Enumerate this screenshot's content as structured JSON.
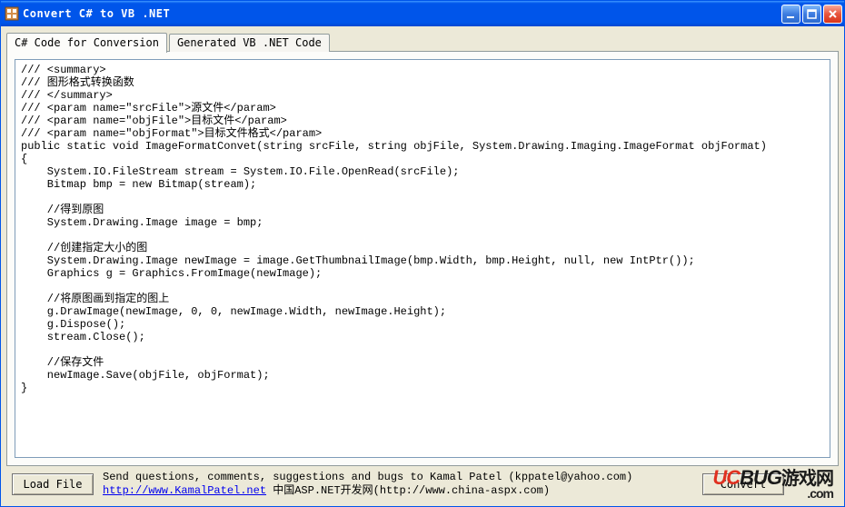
{
  "window": {
    "title": "Convert C# to VB .NET"
  },
  "tabs": {
    "csharp": "C# Code for Conversion",
    "vb": "Generated VB .NET Code"
  },
  "code": "/// <summary>\n/// 图形格式转换函数\n/// </summary>\n/// <param name=\"srcFile\">源文件</param>\n/// <param name=\"objFile\">目标文件</param>\n/// <param name=\"objFormat\">目标文件格式</param>\npublic static void ImageFormatConvet(string srcFile, string objFile, System.Drawing.Imaging.ImageFormat objFormat)\n{\n    System.IO.FileStream stream = System.IO.File.OpenRead(srcFile);\n    Bitmap bmp = new Bitmap(stream);\n\n    //得到原图\n    System.Drawing.Image image = bmp;\n\n    //创建指定大小的图\n    System.Drawing.Image newImage = image.GetThumbnailImage(bmp.Width, bmp.Height, null, new IntPtr());\n    Graphics g = Graphics.FromImage(newImage);\n\n    //将原图画到指定的图上\n    g.DrawImage(newImage, 0, 0, newImage.Width, newImage.Height);\n    g.Dispose();\n    stream.Close();\n\n    //保存文件\n    newImage.Save(objFile, objFormat);\n}",
  "footer": {
    "load_file": "Load File",
    "convert": "Convert",
    "line1": "Send questions, comments, suggestions and bugs to Kamal Patel (kppatel@yahoo.com)",
    "link1": "http://www.KamalPatel.net",
    "line2_mid": "   中国ASP.NET开发网(http://www.china-aspx.com)"
  },
  "watermark": {
    "uc": "UC",
    "bug": "BUG",
    "cn": "游戏网",
    "com": ".com"
  }
}
